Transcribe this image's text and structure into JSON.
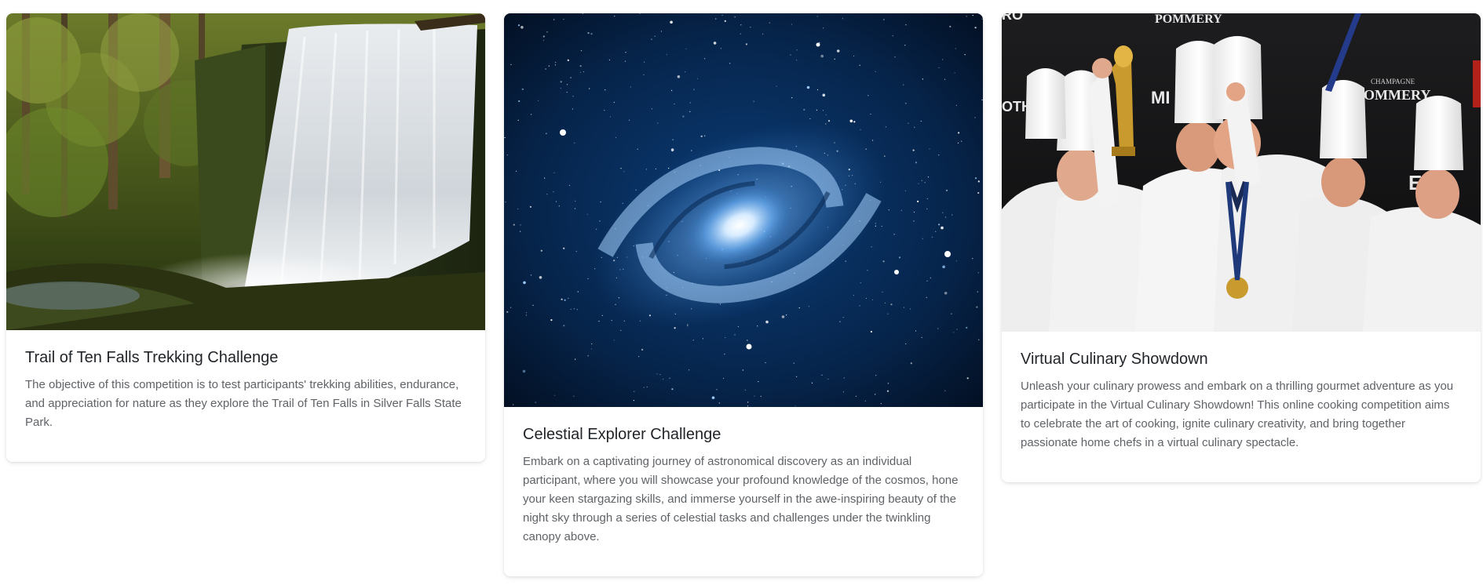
{
  "cards": [
    {
      "title": "Trail of Ten Falls Trekking Challenge",
      "description": "The objective of this competition is to test participants' trekking abilities, endurance, and appreciation for nature as they explore the Trail of Ten Falls in Silver Falls State Park.",
      "image": "waterfall-forest-photo"
    },
    {
      "title": "Celestial Explorer Challenge",
      "description": "Embark on a captivating journey of astronomical discovery as an individual participant, where you will showcase your profound knowledge of the cosmos, hone your keen stargazing skills, and immerse yourself in the awe-inspiring beauty of the night sky through a series of celestial tasks and challenges under the twinkling canopy above.",
      "image": "spiral-galaxy-photo"
    },
    {
      "title": "Virtual Culinary Showdown",
      "description": "Unleash your culinary prowess and embark on a thrilling gourmet adventure as you participate in the Virtual Culinary Showdown! This online cooking competition aims to celebrate the art of cooking, ignite culinary creativity, and bring together passionate home chefs in a virtual culinary spectacle.",
      "image": "celebrating-chefs-photo",
      "image_text": {
        "brand_top": "POMMERY",
        "brand_sub": "CHAMPAGNE",
        "brand_right": "POMMERY",
        "edge_left": "RO",
        "edge_mid": "OTH",
        "edge_mi": "MI",
        "edge_et": "ET"
      }
    }
  ],
  "colors": {
    "title": "#212529",
    "description": "#5f6368",
    "card_bg": "#ffffff",
    "page_bg": "#ffffff"
  }
}
